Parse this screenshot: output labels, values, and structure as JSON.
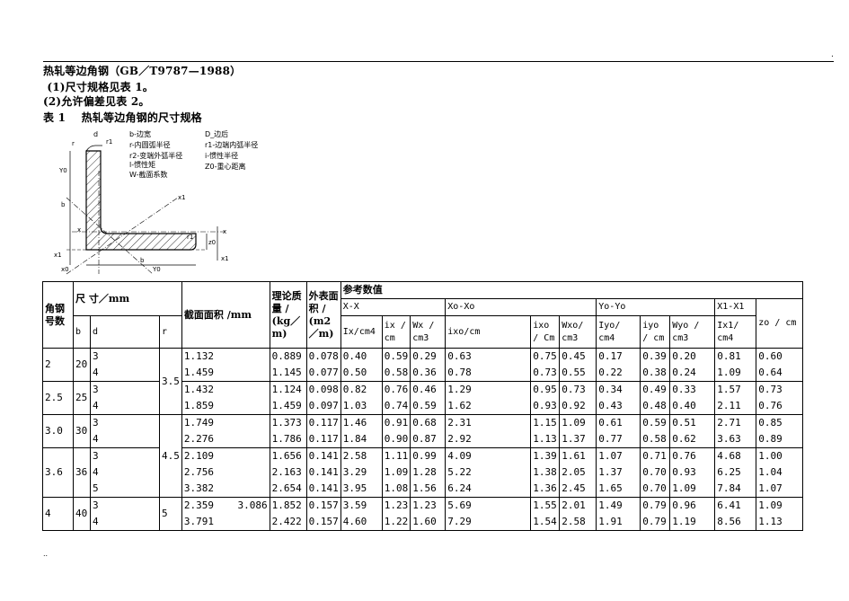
{
  "header": {
    "corner_mark": ".",
    "bottom_mark": "..",
    "title": "热轧等边角钢（GB／T9787—1988）",
    "line2": " (1)尺寸规格见表 1。",
    "line3": "(2)允许偏差见表 2。",
    "line4": "表 1    热轧等边角钢的尺寸规格"
  },
  "diagram": {
    "legend": [
      "b-边宽",
      "D_边后",
      "r-内圆弧半径",
      "r1-边端内弧半径",
      "r2-变端外弧半径",
      "i-惯性半径",
      "l-惯性矩",
      "Z0-重心距离",
      "W-截面系数"
    ],
    "labels": {
      "d": "d",
      "r1_top": "r1",
      "r": "r",
      "y0": "Y0",
      "b": "b",
      "x1": "x1",
      "x": "x",
      "x_left": "x",
      "z0": "z0",
      "r1_mid": "r1",
      "x1_left": "x1",
      "x0": "x0",
      "y0_bottom": "Y0",
      "x1_bottom": "x1",
      "b_bottom": "b"
    }
  },
  "table": {
    "headers": {
      "angle_no": "角钢号数",
      "size": "尺    寸／mm",
      "area": "截面面积 /mm",
      "theo_mass": "理论质量 / (kg／m)",
      "outer_area": "外表面积 / (m2／m)",
      "ref_values": "参考数值",
      "xx": "X-X",
      "x0x0": "Xo-Xo",
      "y0y0": "Yo-Yo",
      "x1x1": "X1-X1",
      "b": "b",
      "d": "d",
      "r": "r",
      "ix_cm4": "Ix/cm4",
      "ix_cm": "ix / cm",
      "wx_cm3": "Wx / cm3",
      "ixo_cm4": "ixo/cm",
      "ixo_cm": "ixo / Cm",
      "wxo_cm3": "Wxo/ cm3",
      "iyo_cm4": "Iyo/ cm4",
      "iyo_cm": "iyo / cm",
      "wyo_cm3": "Wyo / cm3",
      "ix1_cm4": "Ix1/ cm4",
      "zo_cm": "zo / cm"
    },
    "groups": [
      {
        "no": "2",
        "b": "20",
        "d": [
          "3",
          "4"
        ],
        "area": [
          "1.132",
          "1.459"
        ],
        "mass": [
          "0.889",
          "1.145"
        ],
        "outer": [
          "0.078",
          "0.077"
        ],
        "ix": [
          "0.40",
          "0.50"
        ],
        "ixr": [
          "0.59",
          "0.58"
        ],
        "wx": [
          "0.29",
          "0.36"
        ],
        "ixo": [
          "0.63",
          "0.78"
        ],
        "ixor": [
          "0.75",
          "0.73"
        ],
        "wxo": [
          "0.45",
          "0.55"
        ],
        "iyo": [
          "0.17",
          "0.22"
        ],
        "iyor": [
          "0.39",
          "0.38"
        ],
        "wyo": [
          "0.20",
          "0.24"
        ],
        "ix1": [
          "0.81",
          "1.09"
        ],
        "zo": [
          "0.60",
          "0.64"
        ]
      },
      {
        "no": "2.5",
        "b": "25",
        "d": [
          "3",
          "4"
        ],
        "area": [
          "1.432",
          "1.859"
        ],
        "mass": [
          "1.124",
          "1.459"
        ],
        "outer": [
          "0.098",
          "0.097"
        ],
        "ix": [
          "0.82",
          "1.03"
        ],
        "ixr": [
          "0.76",
          "0.74"
        ],
        "wx": [
          "0.46",
          "0.59"
        ],
        "ixo": [
          "1.29",
          "1.62"
        ],
        "ixor": [
          "0.95",
          "0.93"
        ],
        "wxo": [
          "0.73",
          "0.92"
        ],
        "iyo": [
          "0.34",
          "0.43"
        ],
        "iyor": [
          "0.49",
          "0.48"
        ],
        "wyo": [
          "0.33",
          "0.40"
        ],
        "ix1": [
          "1.57",
          "2.11"
        ],
        "zo": [
          "0.73",
          "0.76"
        ]
      },
      {
        "no": "3.0",
        "b": "30",
        "d": [
          "3",
          "4"
        ],
        "area": [
          "1.749",
          "2.276"
        ],
        "mass": [
          "1.373",
          "1.786"
        ],
        "outer": [
          "0.117",
          "0.117"
        ],
        "ix": [
          "1.46",
          "1.84"
        ],
        "ixr": [
          "0.91",
          "0.90"
        ],
        "wx": [
          "0.68",
          "0.87"
        ],
        "ixo": [
          "2.31",
          "2.92"
        ],
        "ixor": [
          "1.15",
          "1.13"
        ],
        "wxo": [
          "1.09",
          "1.37"
        ],
        "iyo": [
          "0.61",
          "0.77"
        ],
        "iyor": [
          "0.59",
          "0.58"
        ],
        "wyo": [
          "0.51",
          "0.62"
        ],
        "ix1": [
          "2.71",
          "3.63"
        ],
        "zo": [
          "0.85",
          "0.89"
        ]
      },
      {
        "no": "3.6",
        "b": "36",
        "d": [
          "3",
          "4",
          "5"
        ],
        "area": [
          "2.109",
          "2.756",
          "3.382"
        ],
        "mass": [
          "1.656",
          "2.163",
          "2.654"
        ],
        "outer": [
          "0.141",
          "0.141",
          "0.141"
        ],
        "ix": [
          "2.58",
          "3.29",
          "3.95"
        ],
        "ixr": [
          "1.11",
          "1.09",
          "1.08"
        ],
        "wx": [
          "0.99",
          "1.28",
          "1.56"
        ],
        "ixo": [
          "4.09",
          "5.22",
          "6.24"
        ],
        "ixor": [
          "1.39",
          "1.38",
          "1.36"
        ],
        "wxo": [
          "1.61",
          "2.05",
          "2.45"
        ],
        "iyo": [
          "1.07",
          "1.37",
          "1.65"
        ],
        "iyor": [
          "0.71",
          "0.70",
          "0.70"
        ],
        "wyo": [
          "0.76",
          "0.93",
          "1.09"
        ],
        "ix1": [
          "4.68",
          "6.25",
          "7.84"
        ],
        "zo": [
          "1.00",
          "1.04",
          "1.07"
        ]
      },
      {
        "no": "4",
        "b": "40",
        "d": [
          "3",
          "4"
        ],
        "area": [
          "2.359",
          "3.791"
        ],
        "area_extra": "3.086",
        "mass": [
          "1.852",
          "2.422"
        ],
        "outer": [
          "0.157",
          "0.157"
        ],
        "ix": [
          "3.59",
          "4.60"
        ],
        "ixr": [
          "1.23",
          "1.22"
        ],
        "wx": [
          "1.23",
          "1.60"
        ],
        "ixo": [
          "5.69",
          "7.29"
        ],
        "ixor": [
          "1.55",
          "1.54"
        ],
        "wxo": [
          "2.01",
          "2.58"
        ],
        "iyo": [
          "1.49",
          "1.91"
        ],
        "iyor": [
          "0.79",
          "0.79"
        ],
        "wyo": [
          "0.96",
          "1.19"
        ],
        "ix1": [
          "6.41",
          "8.56"
        ],
        "zo": [
          "1.09",
          "1.13"
        ]
      }
    ],
    "r_values": [
      "3.5",
      "4.5",
      "5"
    ]
  }
}
